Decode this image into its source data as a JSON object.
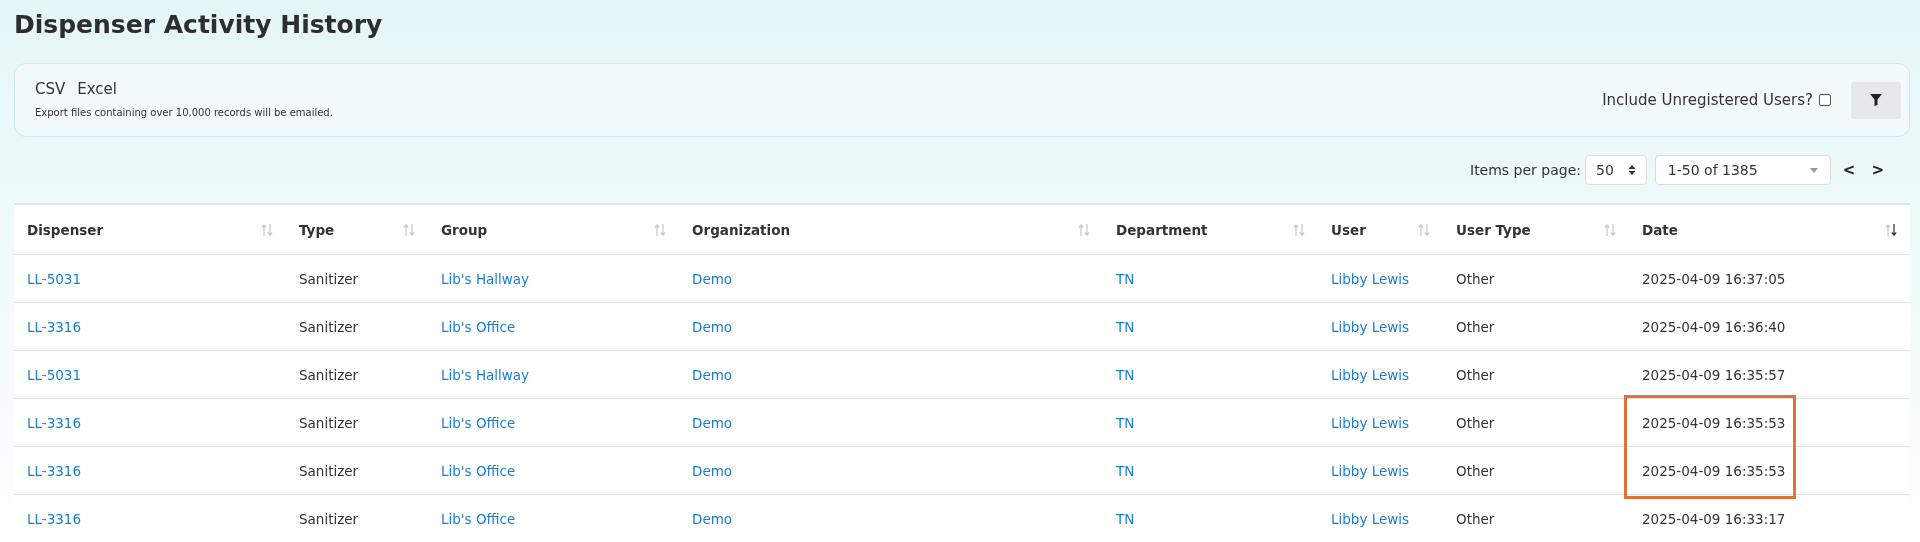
{
  "page": {
    "title": "Dispenser Activity History"
  },
  "export": {
    "buttons": [
      "CSV",
      "Excel"
    ],
    "note": "Export files containing over 10,000 records will be emailed."
  },
  "filters": {
    "unregistered": {
      "label": "Include Unregistered Users?",
      "checked": false
    }
  },
  "pagination": {
    "label": "Items per page:",
    "per_page": "50",
    "range": "1-50 of 1385",
    "prev": "<",
    "next": ">"
  },
  "table": {
    "columns": [
      {
        "label": "Dispenser",
        "sorted": false
      },
      {
        "label": "Type",
        "sorted": false
      },
      {
        "label": "Group",
        "sorted": false
      },
      {
        "label": "Organization",
        "sorted": false
      },
      {
        "label": "Department",
        "sorted": false
      },
      {
        "label": "User",
        "sorted": false
      },
      {
        "label": "User Type",
        "sorted": false
      },
      {
        "label": "Date",
        "sorted": true
      }
    ],
    "rows": [
      {
        "dispenser": "LL-5031",
        "type": "Sanitizer",
        "group": "Lib's Hallway",
        "organization": "Demo",
        "department": "TN",
        "user": "Libby Lewis",
        "user_type": "Other",
        "date": "2025-04-09 16:37:05",
        "highlighted": false
      },
      {
        "dispenser": "LL-3316",
        "type": "Sanitizer",
        "group": "Lib's Office",
        "organization": "Demo",
        "department": "TN",
        "user": "Libby Lewis",
        "user_type": "Other",
        "date": "2025-04-09 16:36:40",
        "highlighted": false
      },
      {
        "dispenser": "LL-5031",
        "type": "Sanitizer",
        "group": "Lib's Hallway",
        "organization": "Demo",
        "department": "TN",
        "user": "Libby Lewis",
        "user_type": "Other",
        "date": "2025-04-09 16:35:57",
        "highlighted": false
      },
      {
        "dispenser": "LL-3316",
        "type": "Sanitizer",
        "group": "Lib's Office",
        "organization": "Demo",
        "department": "TN",
        "user": "Libby Lewis",
        "user_type": "Other",
        "date": "2025-04-09 16:35:53",
        "highlighted": true
      },
      {
        "dispenser": "LL-3316",
        "type": "Sanitizer",
        "group": "Lib's Office",
        "organization": "Demo",
        "department": "TN",
        "user": "Libby Lewis",
        "user_type": "Other",
        "date": "2025-04-09 16:35:53",
        "highlighted": true
      },
      {
        "dispenser": "LL-3316",
        "type": "Sanitizer",
        "group": "Lib's Office",
        "organization": "Demo",
        "department": "TN",
        "user": "Libby Lewis",
        "user_type": "Other",
        "date": "2025-04-09 16:33:17",
        "highlighted": false
      }
    ]
  }
}
